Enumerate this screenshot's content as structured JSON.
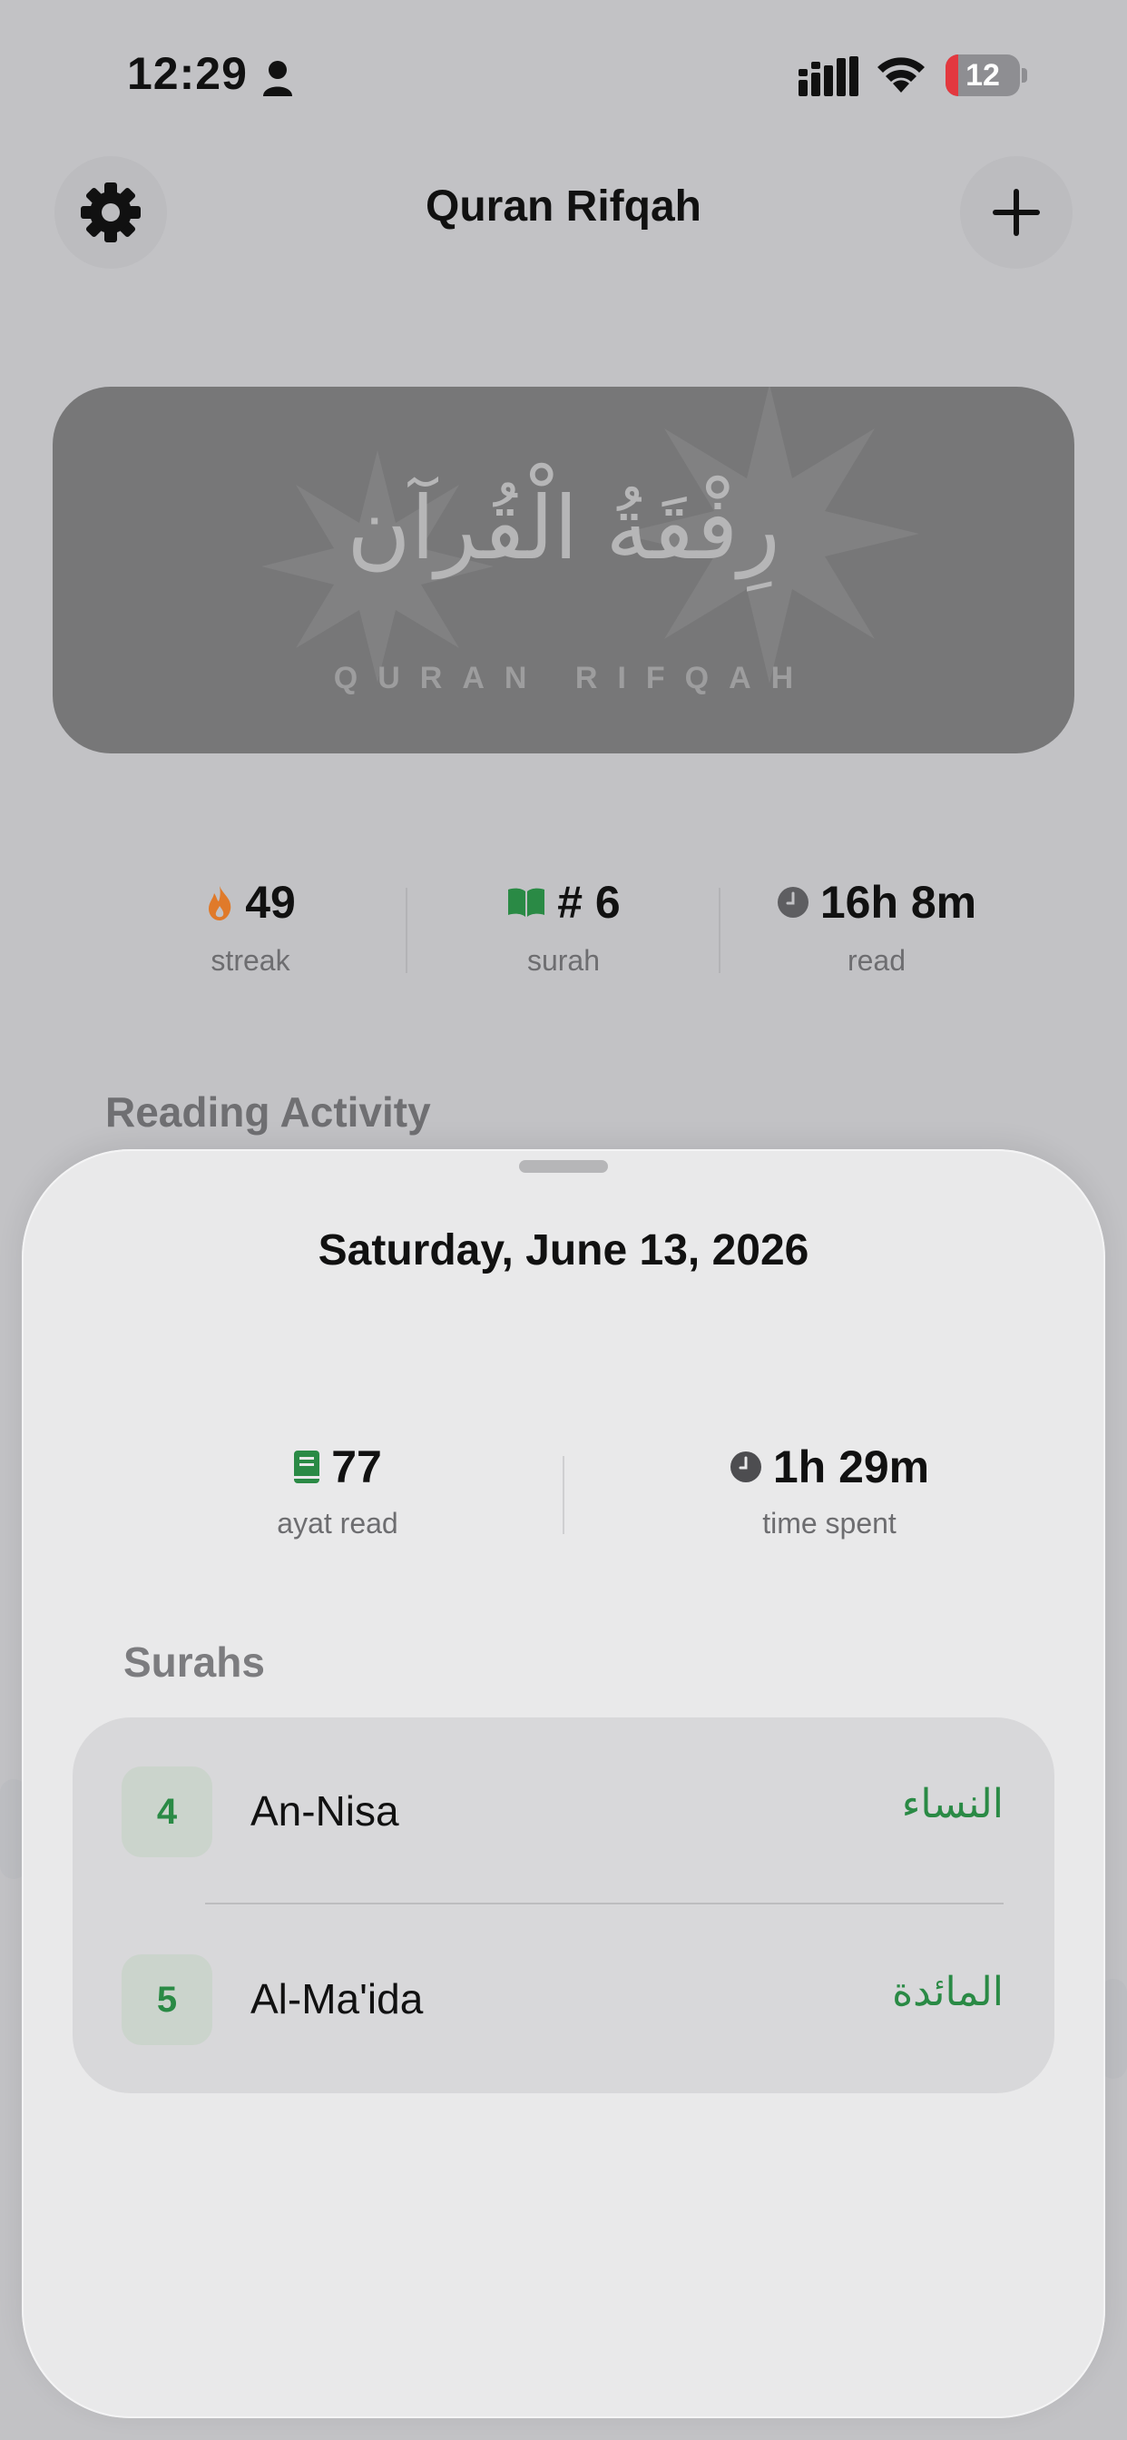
{
  "status_bar": {
    "time": "12:29",
    "battery": "12"
  },
  "header": {
    "title": "Quran Rifqah",
    "settings_icon": "gear-icon",
    "add_icon": "plus-icon"
  },
  "hero": {
    "arabic": "رِفْقَةُ الْقُرآن",
    "latin": "QURAN RIFQAH"
  },
  "stats": [
    {
      "icon": "flame-icon",
      "value": "49",
      "label": "streak"
    },
    {
      "icon": "book-icon",
      "value": "# 6",
      "label": "surah"
    },
    {
      "icon": "clock-icon",
      "value": "16h 8m",
      "label": "read"
    }
  ],
  "reading_activity": {
    "title": "Reading Activity"
  },
  "sheet": {
    "date": "Saturday, June 13, 2026",
    "stats": [
      {
        "icon": "book-icon",
        "value": "77",
        "label": "ayat read"
      },
      {
        "icon": "clock-icon",
        "value": "1h 29m",
        "label": "time spent"
      }
    ],
    "surahs_title": "Surahs",
    "surahs": [
      {
        "number": "4",
        "name": "An-Nisa",
        "arabic": "النساء"
      },
      {
        "number": "5",
        "name": "Al-Ma'ida",
        "arabic": "المائدة"
      }
    ]
  },
  "colors": {
    "accent_green": "#2a8a45",
    "streak_orange": "#e07a2a",
    "sheet_bg": "#e9e9ea"
  }
}
